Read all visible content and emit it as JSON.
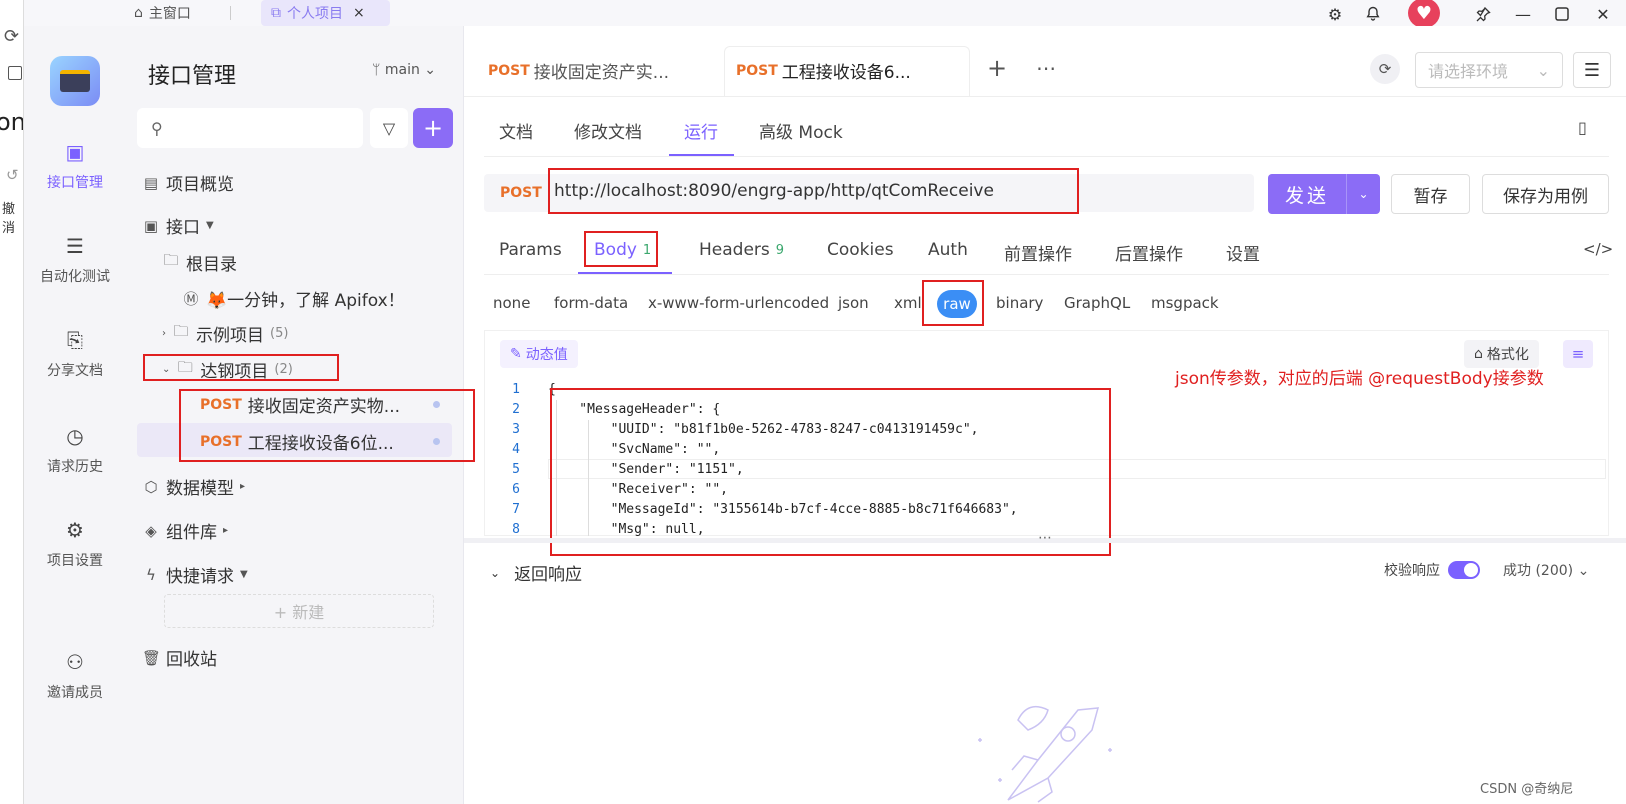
{
  "topbar": {
    "home_label": "主窗口",
    "project_tab": "个人项目",
    "close": "×"
  },
  "strip": {
    "partial_text": "on",
    "undo_label": "撤消"
  },
  "rail": {
    "items": [
      {
        "label": "接口管理",
        "icon": "api-icon"
      },
      {
        "label": "自动化测试",
        "icon": "automation-icon"
      },
      {
        "label": "分享文档",
        "icon": "share-doc-icon"
      },
      {
        "label": "请求历史",
        "icon": "history-icon"
      },
      {
        "label": "项目设置",
        "icon": "settings-icon"
      },
      {
        "label": "邀请成员",
        "icon": "invite-icon"
      }
    ]
  },
  "sidebar": {
    "title": "接口管理",
    "branch": "main",
    "new_label": "+ 新建",
    "tree": {
      "overview": "项目概览",
      "apis": "接口",
      "root": "根目录",
      "intro": "🦊一分钟，了解 Apifox！",
      "example": "示例项目",
      "example_count": "(5)",
      "dagang": "达钢项目",
      "dagang_count": "(2)",
      "api1_method": "POST",
      "api1_name": "接收固定资产实物...",
      "api2_method": "POST",
      "api2_name": "工程接收设备6位...",
      "models": "数据模型",
      "components": "组件库",
      "quick": "快捷请求",
      "trash": "回收站"
    }
  },
  "tabs": {
    "tab1_method": "POST",
    "tab1_name": "接收固定资产实...",
    "tab2_method": "POST",
    "tab2_name": "工程接收设备6...",
    "env_placeholder": "请选择环境"
  },
  "subtabs": [
    "文档",
    "修改文档",
    "运行",
    "高级 Mock"
  ],
  "request": {
    "method": "POST",
    "url": "http://localhost:8090/engrg-app/http/qtComReceive",
    "send": "发送",
    "save_temp": "暂存",
    "save_case": "保存为用例"
  },
  "reqtabs": {
    "params": "Params",
    "body": "Body",
    "body_count": "1",
    "headers": "Headers",
    "headers_count": "9",
    "cookies": "Cookies",
    "auth": "Auth",
    "pre": "前置操作",
    "post": "后置操作",
    "settings": "设置"
  },
  "body_types": [
    "none",
    "form-data",
    "x-www-form-urlencoded",
    "json",
    "xml",
    "raw",
    "binary",
    "GraphQL",
    "msgpack"
  ],
  "editor": {
    "dynamic": "动态值",
    "format": "格式化",
    "annotation": "json传参数，对应的后端 @requestBody接参数",
    "lines": [
      "{",
      "    \"MessageHeader\": {",
      "        \"UUID\": \"b81f1b0e-5262-4783-8247-c0413191459c\",",
      "        \"SvcName\": \"\",",
      "        \"Sender\": \"1151\",",
      "        \"Receiver\": \"\",",
      "        \"MessageId\": \"3155614b-b7cf-4cce-8885-b8c71f646683\",",
      "        \"Msg\": null,"
    ],
    "line_numbers": [
      "1",
      "2",
      "3",
      "4",
      "5",
      "6",
      "7",
      "8"
    ]
  },
  "response": {
    "title": "返回响应",
    "verify": "校验响应",
    "status": "成功 (200)"
  },
  "watermark": "CSDN @奇纳尼"
}
